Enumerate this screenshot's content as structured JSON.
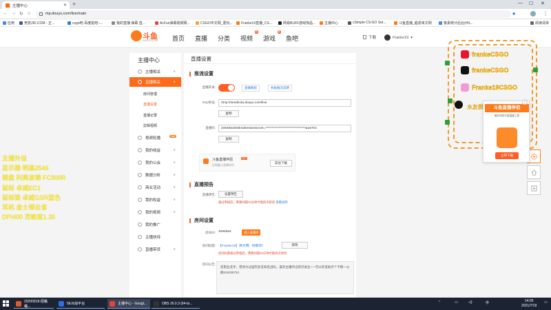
{
  "browser": {
    "tab_title": "主播中心",
    "url": "mp.douyu.com/live/main",
    "bookmarks": [
      {
        "label": "应用",
        "color": "#4285f4"
      },
      {
        "label": "竞技JID.COM - 正...",
        "color": "#3b5998"
      },
      {
        "label": "csgo吧-百度贴吧--...",
        "color": "#2f7de1"
      },
      {
        "label": "我的直播 弹幕 直...",
        "color": "#888888"
      },
      {
        "label": "AcFun弹幕视频网...",
        "color": "#e2453c"
      },
      {
        "label": "CSGO中文网_更玩...",
        "color": "#f2a33a"
      },
      {
        "label": "Franke19直播_CS...",
        "color": "#ff7a1a"
      },
      {
        "label": "网易BUFF游戏饰品...",
        "color": "#222222"
      },
      {
        "label": "主播中心",
        "color": "#ff7a1a"
      },
      {
        "label": "cSimple CS:GO Set...",
        "color": "#555555"
      },
      {
        "label": "斗鱼直播_超虐单文网",
        "color": "#ff7a1a"
      },
      {
        "label": "像素统计后台(HS...",
        "color": "#3a8ee6"
      },
      {
        "label": "阅读清单",
        "color": "#666666"
      }
    ]
  },
  "header": {
    "logo_text": "斗鱼",
    "logo_sub": "DOUYU.COM",
    "nav": [
      {
        "label": "首页",
        "badge": ""
      },
      {
        "label": "直播",
        "badge": ""
      },
      {
        "label": "分类",
        "badge": ""
      },
      {
        "label": "视频",
        "badge": "热"
      },
      {
        "label": "游戏",
        "badge": "新"
      },
      {
        "label": "鱼吧",
        "badge": ""
      }
    ],
    "download": "下载",
    "username": "Franke19"
  },
  "sidebar": {
    "title": "主播中心",
    "items": [
      {
        "label": "主播相关",
        "chev": "∧",
        "type": "item"
      },
      {
        "label": "直播相关",
        "chev": "∧",
        "type": "item-active"
      },
      {
        "label": "房间管理",
        "type": "sub"
      },
      {
        "label": "直播设置",
        "type": "sub-active"
      },
      {
        "label": "直播记录",
        "type": "sub"
      },
      {
        "label": "剪辑视频",
        "type": "sub"
      },
      {
        "label": "视频轮播",
        "chev": "",
        "type": "item",
        "tag": "new"
      },
      {
        "label": "我的收益",
        "chev": "∨",
        "type": "item"
      },
      {
        "label": "我的公会",
        "chev": "∨",
        "type": "item"
      },
      {
        "label": "数据分析",
        "chev": "∨",
        "type": "item"
      },
      {
        "label": "商业活动",
        "chev": "∨",
        "type": "item"
      },
      {
        "label": "我的权益",
        "chev": "∨",
        "type": "item"
      },
      {
        "label": "我的视频",
        "chev": "∨",
        "type": "item"
      },
      {
        "label": "我的推广",
        "chev": "",
        "type": "item"
      },
      {
        "label": "主播扶持",
        "chev": "",
        "type": "item"
      },
      {
        "label": "直播带货",
        "chev": "∨",
        "type": "item"
      }
    ]
  },
  "main": {
    "title": "直播设置",
    "stream": {
      "section_title": "推流设置",
      "switch_label": "直播开关:",
      "link1": "直播教程",
      "link2": "抗极推流说明",
      "rtmp_label": "rtmp地址:",
      "rtmp_value": "rtmp://sendtc3a.douyu.com/live",
      "copy1": "复制",
      "code_label": "直播码:",
      "code_value": "3494554rE6lmdeeIIwsSecret=*******************************&wsTim",
      "copy2": "复制",
      "promo_title": "斗鱼直播伴侣",
      "promo_hot": "HOT",
      "promo_sub": "近期最火直播伴侣",
      "promo_btn": "前往下载"
    },
    "preview": {
      "section_title": "直播预告",
      "label": "直播预告:",
      "btn": "设置预告",
      "warn": "通过审核后，需要间隔10分钟才能再次修改",
      "link": "查看说明"
    },
    "room": {
      "section_title": "房间设置",
      "id_label": "房间ID:",
      "id_value": "3494554",
      "id_btn": "进入直播间",
      "name_label": "房间标题:",
      "name_value": "【Franke19】讲文明、树新风！",
      "name_btn": "修改",
      "name_warn": "房间标题通过审核后，需要间隔10分钟才能再次修改",
      "ann_label": "房间公告:",
      "ann_text": "前职业选手，曾效力过国内多支知名战队。喜欢主播的记得点关注~一可以的话再点个卡噢~~Q群915035753"
    }
  },
  "overlay": {
    "left_lines": [
      "主播外设",
      "显示器  明基2546",
      "键盘  利奥波德 FC900R",
      "鼠标  卓威EC1",
      "鼠标垫  卓威GSR蓝色",
      "耳机  金士顿云雀",
      "DPI400  灵敏度1.35"
    ],
    "socials": [
      {
        "name": "weibo",
        "label": "frankeCSGO",
        "color": "#e6162d"
      },
      {
        "name": "tiktok",
        "label": "frankeCSGO",
        "color": "#111111"
      },
      {
        "name": "huya-app",
        "label": "Franke19CSGO",
        "color": "#f39ad2"
      }
    ],
    "qq_label": "水友群  915035753",
    "popup": {
      "title": "斗鱼直播伴侣",
      "desc": "最好用的代直直播工具",
      "btn": "立即下载"
    }
  },
  "taskbar": {
    "apps": [
      {
        "label": "20200918-把蛐蛐...",
        "color": "#e05a2b"
      },
      {
        "label": "5E对战平台",
        "color": "#2b6fe0"
      },
      {
        "label": "主播中心 - Googl...",
        "color": "#ea4335",
        "active": true
      },
      {
        "label": "OBS 26.0.3 (64-bi...",
        "color": "#333333"
      }
    ],
    "time": "14:09",
    "date": "2021/7/19",
    "ime": "中"
  }
}
